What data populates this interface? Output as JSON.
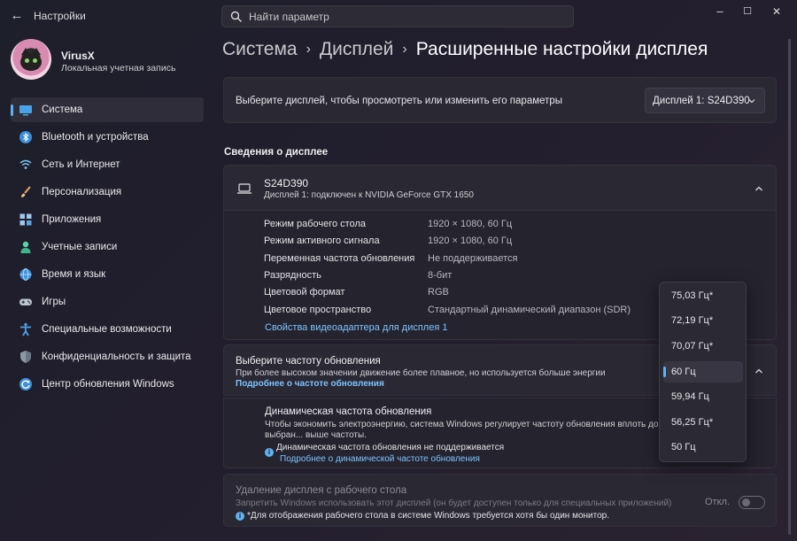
{
  "window": {
    "title": "Настройки",
    "back_glyph": "←",
    "minimize_glyph": "–",
    "maximize_glyph": "☐",
    "close_glyph": "✕"
  },
  "search": {
    "placeholder": "Найти параметр"
  },
  "profile": {
    "name": "VirusX",
    "account_type": "Локальная учетная запись"
  },
  "sidebar": {
    "items": [
      {
        "label": "Система",
        "icon": "system-icon",
        "active": true
      },
      {
        "label": "Bluetooth и устройства",
        "icon": "bluetooth-icon"
      },
      {
        "label": "Сеть и Интернет",
        "icon": "wifi-icon"
      },
      {
        "label": "Персонализация",
        "icon": "brush-icon"
      },
      {
        "label": "Приложения",
        "icon": "apps-icon"
      },
      {
        "label": "Учетные записи",
        "icon": "account-icon"
      },
      {
        "label": "Время и язык",
        "icon": "globe-icon"
      },
      {
        "label": "Игры",
        "icon": "gamepad-icon"
      },
      {
        "label": "Специальные возможности",
        "icon": "accessibility-icon"
      },
      {
        "label": "Конфиденциальность и защита",
        "icon": "shield-icon"
      },
      {
        "label": "Центр обновления Windows",
        "icon": "update-icon"
      }
    ]
  },
  "breadcrumb": {
    "items": [
      "Система",
      "Дисплей"
    ],
    "separator": "›",
    "current": "Расширенные настройки дисплея"
  },
  "choose_display": {
    "label": "Выберите дисплей, чтобы просмотреть или изменить его параметры",
    "selected": "Дисплей 1: S24D390"
  },
  "display_info": {
    "section_title": "Сведения о дисплее",
    "monitor_name": "S24D390",
    "monitor_subtitle": "Дисплей 1: подключен к NVIDIA GeForce GTX 1650",
    "rows": [
      {
        "key": "Режим рабочего стола",
        "value": "1920 × 1080, 60 Гц"
      },
      {
        "key": "Режим активного сигнала",
        "value": "1920 × 1080, 60 Гц"
      },
      {
        "key": "Переменная частота обновления",
        "value": "Не поддерживается"
      },
      {
        "key": "Разрядность",
        "value": "8-бит"
      },
      {
        "key": "Цветовой формат",
        "value": "RGB"
      },
      {
        "key": "Цветовое пространство",
        "value": "Стандартный динамический диапазон (SDR)"
      }
    ],
    "adapter_link": "Свойства видеоадаптера для дисплея 1"
  },
  "refresh_rate": {
    "title": "Выберите частоту обновления",
    "description": "При более высоком значении движение более плавное, но используется больше энергии",
    "link": "Подробнее о частоте обновления",
    "selected": "60 Гц",
    "options": [
      "75,03 Гц*",
      "72,19 Гц*",
      "70,07 Гц*",
      "60 Гц",
      "59,94 Гц",
      "56,25 Гц*",
      "50 Гц"
    ]
  },
  "dynamic_refresh": {
    "title": "Динамическая частота обновления",
    "description": "Чтобы экономить электроэнергию, система Windows регулирует частоту обновления вплоть до выбран... выше частоты.",
    "note": "Динамическая частота обновления не поддерживается",
    "link": "Подробнее о динамической частоте обновления"
  },
  "remove_display": {
    "title": "Удаление дисплея с рабочего стола",
    "description": "Запретить Windows использовать этот дисплей (он будет доступен только для специальных приложений)",
    "note": "*Для отображения рабочего стола в системе Windows требуется хотя бы один монитор.",
    "toggle_label": "Откл.",
    "toggle_on": false
  },
  "colors": {
    "accent": "#5fb2f2",
    "link": "#7cc3ff"
  }
}
